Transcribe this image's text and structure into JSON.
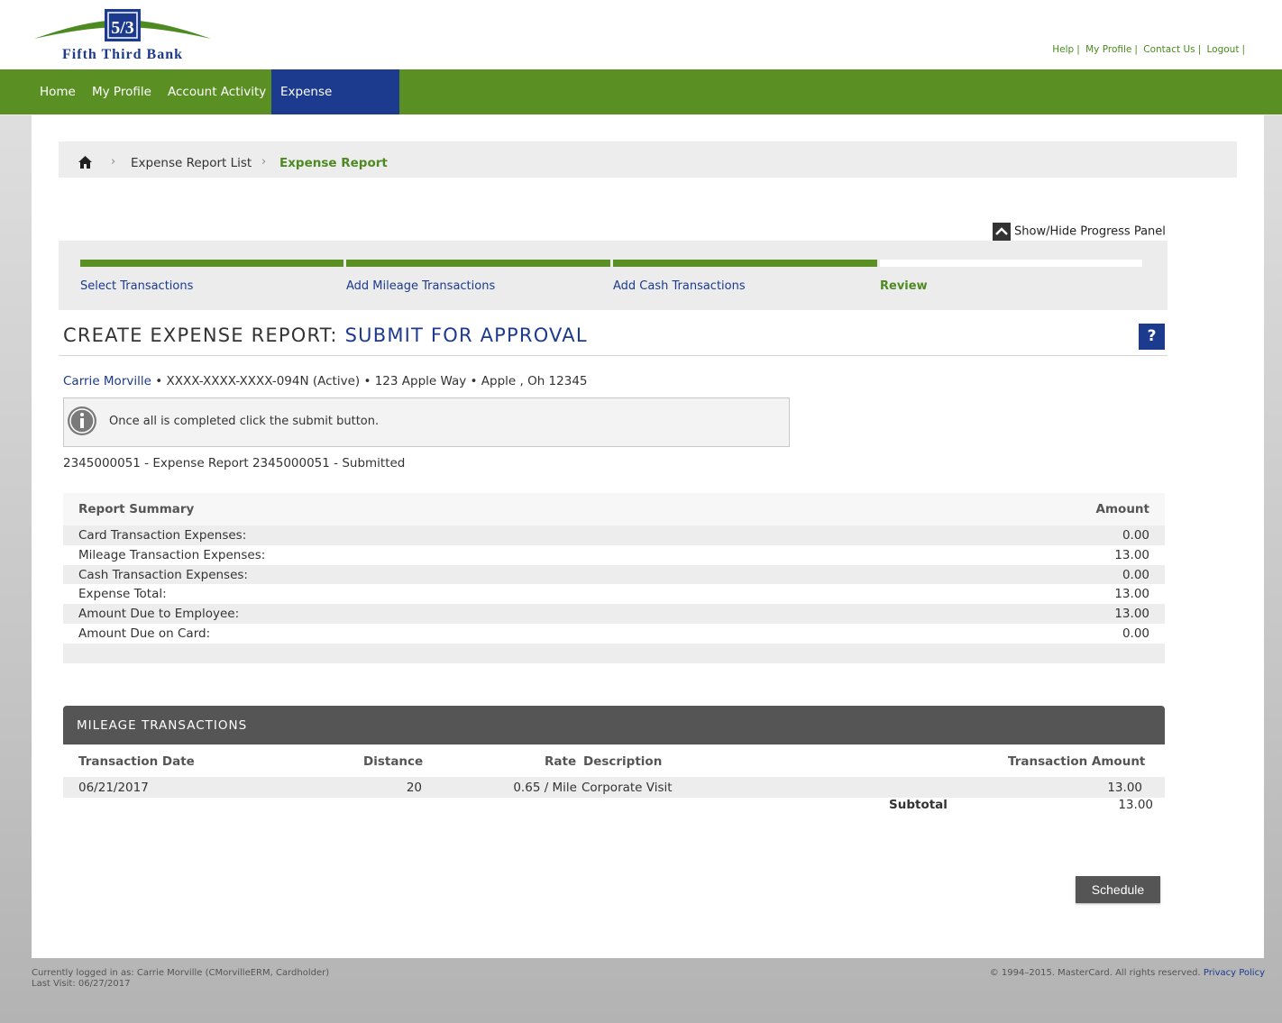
{
  "brand": {
    "name": "Fifth Third Bank",
    "mark": "5/3",
    "color_primary": "#1c3a8e",
    "color_green": "#5a8f23"
  },
  "top_links": [
    "Help",
    "My Profile",
    "Contact Us",
    "Logout"
  ],
  "nav": {
    "items": [
      "Home",
      "My Profile",
      "Account Activity",
      "Expense Reporting"
    ],
    "active": "Expense Reporting"
  },
  "breadcrumb": {
    "home_icon": "home-icon",
    "items": [
      "Expense Report List",
      "Expense Report"
    ]
  },
  "progress_toggle": "Show/Hide Progress Panel",
  "progress_steps": [
    {
      "label": "Select Transactions",
      "complete": true
    },
    {
      "label": "Add Mileage Transactions",
      "complete": true
    },
    {
      "label": "Add Cash Transactions",
      "complete": true
    },
    {
      "label": "Review",
      "complete": false,
      "current": true
    }
  ],
  "title": {
    "prefix": "CREATE EXPENSE REPORT:",
    "accent": "SUBMIT FOR APPROVAL"
  },
  "help_label": "?",
  "cardholder": {
    "name": "Carrie Morville",
    "details": "• XXXX-XXXX-XXXX-094N (Active)  • 123 Apple Way • Apple , Oh 12345"
  },
  "info_message": "Once all is completed click the submit button.",
  "report_line": "2345000051 - Expense Report 2345000051 - Submitted",
  "summary": {
    "header_label": "Report Summary",
    "header_amount": "Amount",
    "rows": [
      {
        "label": "Card Transaction Expenses:",
        "amount": "0.00"
      },
      {
        "label": "Mileage Transaction Expenses:",
        "amount": "13.00"
      },
      {
        "label": "Cash Transaction Expenses:",
        "amount": "0.00"
      },
      {
        "label": "Expense Total:",
        "amount": "13.00"
      },
      {
        "label": "Amount Due to Employee:",
        "amount": "13.00"
      },
      {
        "label": "Amount Due on Card:",
        "amount": "0.00"
      }
    ]
  },
  "mileage": {
    "title": "MILEAGE TRANSACTIONS",
    "columns": [
      "Transaction Date",
      "Distance",
      "Rate",
      "Description",
      "Transaction Amount"
    ],
    "rows": [
      {
        "date": "06/21/2017",
        "distance": "20",
        "rate": "0.65 / Mile",
        "description": "Corporate Visit",
        "amount": "13.00"
      }
    ],
    "subtotal_label": "Subtotal",
    "subtotal_value": "13.00"
  },
  "schedule_button": "Schedule",
  "footer": {
    "logged_in": "Currently logged in as: Carrie Morville (CMorvilleERM, Cardholder)",
    "last_visit": "Last Visit: 06/27/2017",
    "copyright": "© 1994–2015. MasterCard. All rights reserved.",
    "privacy": "Privacy Policy"
  }
}
